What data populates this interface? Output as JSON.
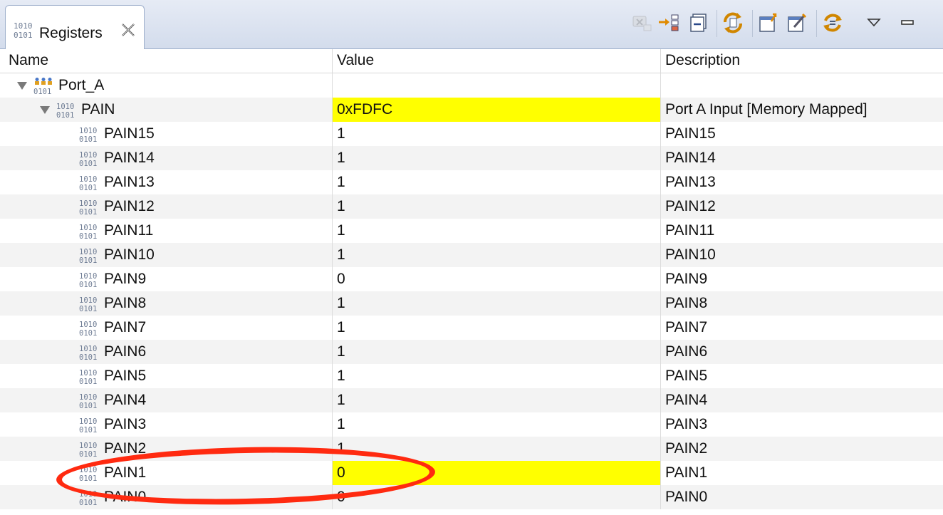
{
  "tab": {
    "label": "Registers",
    "icon": "binary-register-icon",
    "close_icon": "close-icon"
  },
  "toolbar": {
    "icons": [
      "disabled-action-icon",
      "move-to-tree-icon",
      "collapse-all-icon",
      "sync-registers-icon",
      "new-export-icon",
      "edit-import-icon",
      "refresh-icon",
      "view-menu-icon",
      "minimize-icon"
    ]
  },
  "columns": [
    "Name",
    "Value",
    "Description"
  ],
  "rows": [
    {
      "name": "Port_A",
      "value": "",
      "description": "",
      "level": 0,
      "expanded": true,
      "icon": "register-group-icon",
      "highlight": false
    },
    {
      "name": "PAIN",
      "value": "0xFDFC",
      "description": "Port A Input [Memory Mapped]",
      "level": 1,
      "expanded": true,
      "icon": "binary-register-icon",
      "highlight": true
    },
    {
      "name": "PAIN15",
      "value": "1",
      "description": "PAIN15",
      "level": 2,
      "icon": "binary-register-icon",
      "highlight": false
    },
    {
      "name": "PAIN14",
      "value": "1",
      "description": "PAIN14",
      "level": 2,
      "icon": "binary-register-icon",
      "highlight": false
    },
    {
      "name": "PAIN13",
      "value": "1",
      "description": "PAIN13",
      "level": 2,
      "icon": "binary-register-icon",
      "highlight": false
    },
    {
      "name": "PAIN12",
      "value": "1",
      "description": "PAIN12",
      "level": 2,
      "icon": "binary-register-icon",
      "highlight": false
    },
    {
      "name": "PAIN11",
      "value": "1",
      "description": "PAIN11",
      "level": 2,
      "icon": "binary-register-icon",
      "highlight": false
    },
    {
      "name": "PAIN10",
      "value": "1",
      "description": "PAIN10",
      "level": 2,
      "icon": "binary-register-icon",
      "highlight": false
    },
    {
      "name": "PAIN9",
      "value": "0",
      "description": "PAIN9",
      "level": 2,
      "icon": "binary-register-icon",
      "highlight": false
    },
    {
      "name": "PAIN8",
      "value": "1",
      "description": "PAIN8",
      "level": 2,
      "icon": "binary-register-icon",
      "highlight": false
    },
    {
      "name": "PAIN7",
      "value": "1",
      "description": "PAIN7",
      "level": 2,
      "icon": "binary-register-icon",
      "highlight": false
    },
    {
      "name": "PAIN6",
      "value": "1",
      "description": "PAIN6",
      "level": 2,
      "icon": "binary-register-icon",
      "highlight": false
    },
    {
      "name": "PAIN5",
      "value": "1",
      "description": "PAIN5",
      "level": 2,
      "icon": "binary-register-icon",
      "highlight": false
    },
    {
      "name": "PAIN4",
      "value": "1",
      "description": "PAIN4",
      "level": 2,
      "icon": "binary-register-icon",
      "highlight": false
    },
    {
      "name": "PAIN3",
      "value": "1",
      "description": "PAIN3",
      "level": 2,
      "icon": "binary-register-icon",
      "highlight": false
    },
    {
      "name": "PAIN2",
      "value": "1",
      "description": "PAIN2",
      "level": 2,
      "icon": "binary-register-icon",
      "highlight": false
    },
    {
      "name": "PAIN1",
      "value": "0",
      "description": "PAIN1",
      "level": 2,
      "icon": "binary-register-icon",
      "highlight": true
    },
    {
      "name": "PAIN0",
      "value": "0",
      "description": "PAIN0",
      "level": 2,
      "icon": "binary-register-icon",
      "highlight": false
    }
  ],
  "colors": {
    "highlight": "#ffff00",
    "annotation": "#ff2a10",
    "stripe": "#f3f3f3"
  },
  "annotation": {
    "shape": "ellipse",
    "target": "PAIN1"
  }
}
